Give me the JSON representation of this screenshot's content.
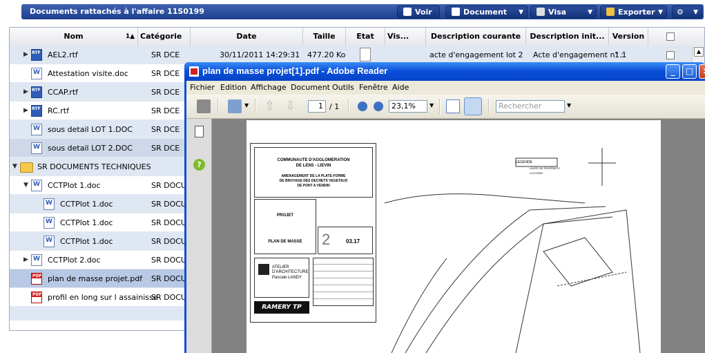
{
  "topbar": {
    "title": "Documents rattachés à l'affaire 11S0199",
    "buttons": {
      "voir": "Voir",
      "document": "Document",
      "visa": "Visa",
      "exporter": "Exporter"
    }
  },
  "grid": {
    "headers": {
      "nom": "Nom",
      "sort": "1▲",
      "categorie": "Catégorie",
      "date": "Date",
      "taille": "Taille",
      "etat": "Etat",
      "vis": "Vis...",
      "desc_courante": "Description courante",
      "desc_init": "Description init...",
      "version": "Version"
    },
    "rows": [
      {
        "nom": "AEL2.rtf",
        "cat": "SR DCE",
        "date": "30/11/2011 14:29:31",
        "taille": "477.20 Ko",
        "desc": "acte d'engagement lot 2",
        "desc_init": "Acte d'engagement n° :",
        "version": "1.1"
      },
      {
        "nom": "Attestation visite.doc",
        "cat": "SR DCE"
      },
      {
        "nom": "CCAP.rtf",
        "cat": "SR DCE"
      },
      {
        "nom": "RC.rtf",
        "cat": "SR DCE"
      },
      {
        "nom": "sous detail LOT 1.DOC",
        "cat": "SR DCE"
      },
      {
        "nom": "sous detail LOT 2.DOC",
        "cat": "SR DCE"
      },
      {
        "nom": "SR DOCUMENTS TECHNIQUES",
        "cat": ""
      },
      {
        "nom": "CCTPlot 1.doc",
        "cat": "SR DOCUI"
      },
      {
        "nom": "CCTPlot 1.doc",
        "cat": "SR DOCUI"
      },
      {
        "nom": "CCTPlot 1.doc",
        "cat": "SR DOCUI"
      },
      {
        "nom": "CCTPlot 1.doc",
        "cat": "SR DOCUI"
      },
      {
        "nom": "CCTPlot 2.doc",
        "cat": "SR DOCUI"
      },
      {
        "nom": "plan de masse projet.pdf",
        "cat": "SR DOCUI"
      },
      {
        "nom": "profil en long sur l assainisse",
        "cat": "SR DOCUI"
      }
    ]
  },
  "reader": {
    "title": "plan de masse projet[1].pdf - Adobe Reader",
    "menu": [
      "Fichier",
      "Edition",
      "Affichage",
      "Document",
      "Outils",
      "Fenêtre",
      "Aide"
    ],
    "page_current": "1",
    "page_total": "/ 1",
    "zoom": "23,1%",
    "search_placeholder": "Rechercher"
  },
  "plan": {
    "line1": "COMMUNAUTE D'AGGLOMERATION",
    "line2": "DE LENS - LIEVIN",
    "line3": "AMENAGEMENT DE LA PLATE-FORME",
    "line4": "DE BROYAGE DES DECHETS VEGETAUX",
    "line5": "DE PONT A VENDIN",
    "projet": "PROJET",
    "plan_masse": "PLAN DE MASSE",
    "num": "2",
    "ref": "03.17",
    "atelier": "ATELIER",
    "archi": "D'ARCHITECTURE",
    "name": "Pascale LANDY",
    "ramery": "RAMERY TP",
    "legende": "LEGENDE",
    "limite": "LIMITE DE PROPRIETE",
    "cloture": "CLOTURE"
  }
}
